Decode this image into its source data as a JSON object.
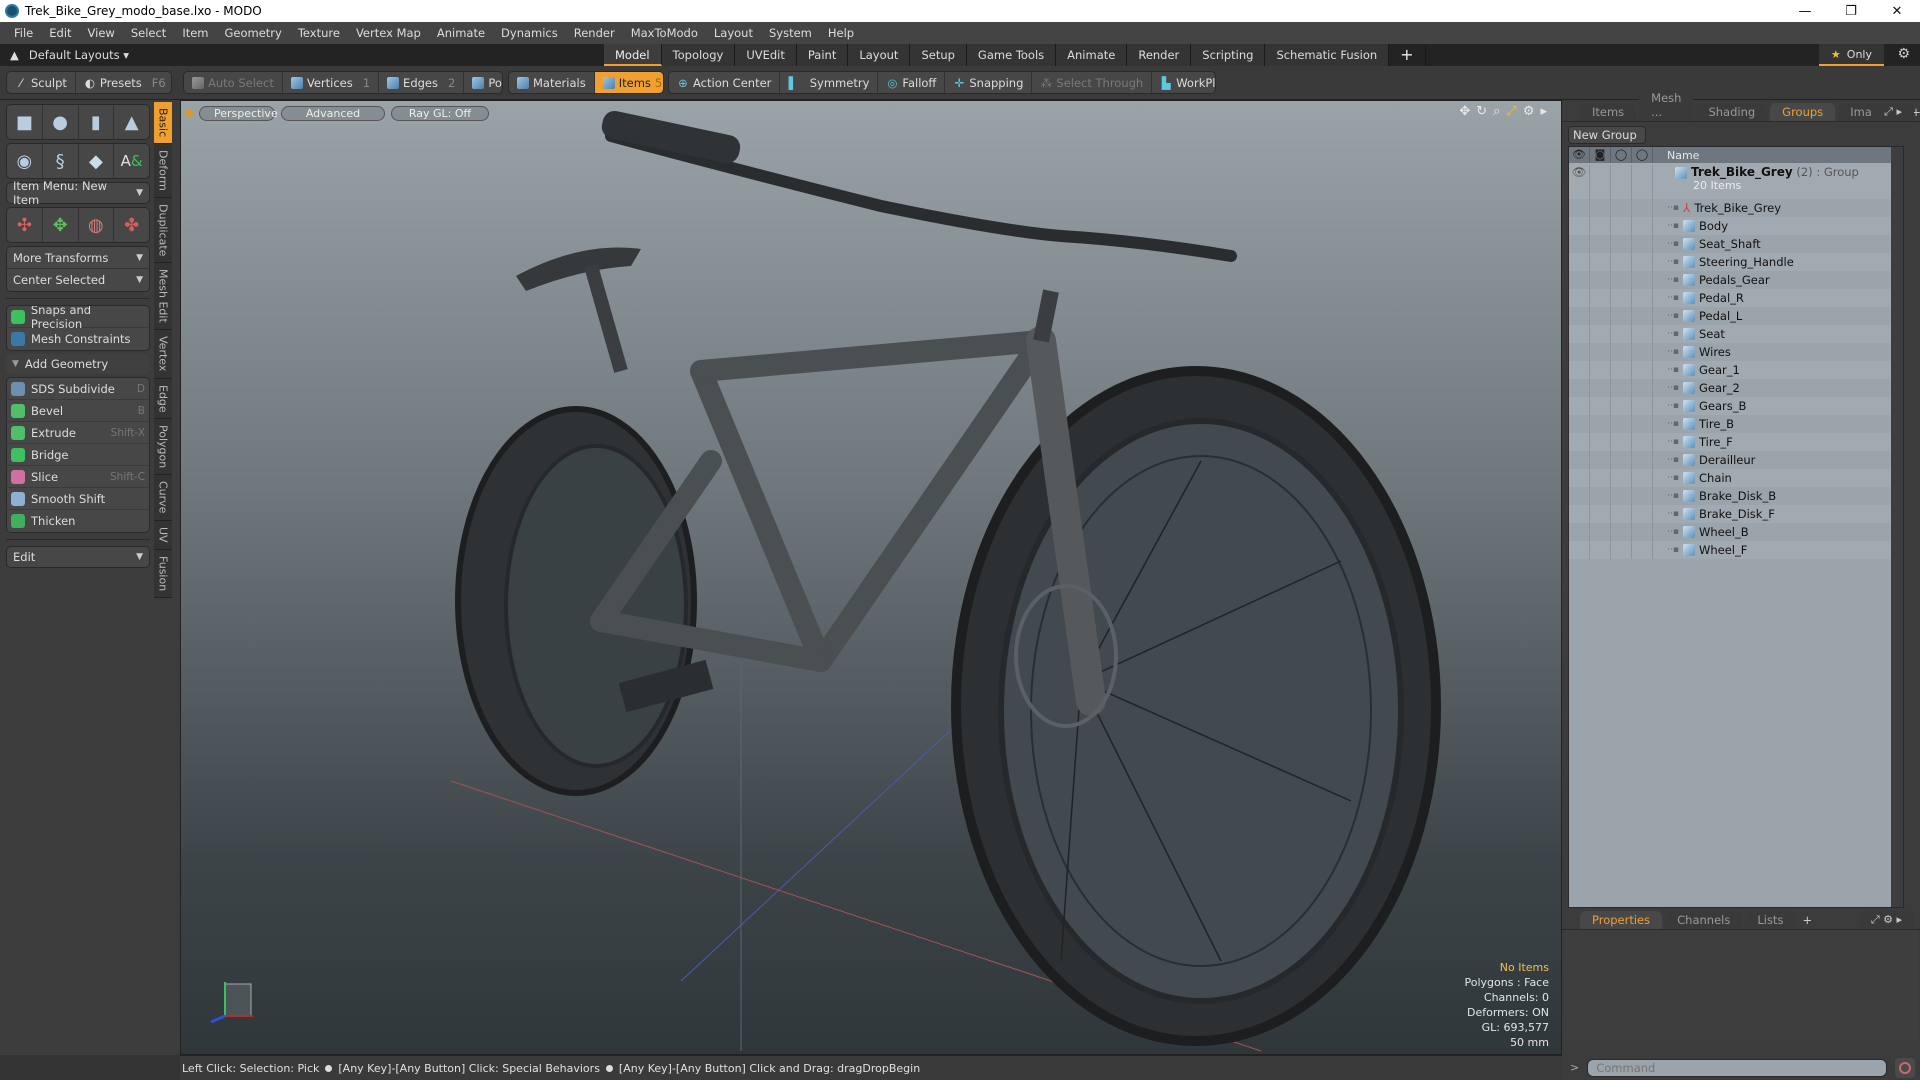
{
  "window": {
    "title": "Trek_Bike_Grey_modo_base.lxo - MODO",
    "controls": [
      "minimize",
      "restore",
      "close"
    ]
  },
  "menu": [
    "File",
    "Edit",
    "View",
    "Select",
    "Item",
    "Geometry",
    "Texture",
    "Vertex Map",
    "Animate",
    "Dynamics",
    "Render",
    "MaxToModo",
    "Layout",
    "System",
    "Help"
  ],
  "layouts": {
    "label": "Default Layouts",
    "tabs": [
      "Model",
      "Topology",
      "UVEdit",
      "Paint",
      "Layout",
      "Setup",
      "Game Tools",
      "Animate",
      "Render",
      "Scripting",
      "Schematic Fusion"
    ],
    "active_tab": "Model",
    "add": "+",
    "only_label": "Only"
  },
  "toolbar": {
    "sculpt": "Sculpt",
    "presets": "Presets",
    "presets_key": "F6",
    "auto_select": "Auto Select",
    "vertices": "Vertices",
    "vertices_key": "1",
    "edges": "Edges",
    "edges_key": "2",
    "polygons": "Polygons",
    "materials": "Materials",
    "items": "Items",
    "items_key": "5",
    "action_center": "Action Center",
    "symmetry": "Symmetry",
    "falloff": "Falloff",
    "snapping": "Snapping",
    "select_through": "Select Through",
    "workplane": "WorkPlane"
  },
  "left_panel": {
    "item_menu": "Item Menu: New Item",
    "more_transforms": "More Transforms",
    "center_selected": "Center Selected",
    "snaps": "Snaps and Precision",
    "mesh_constraints": "Mesh Constraints",
    "add_geometry": "Add Geometry",
    "tools": [
      {
        "label": "SDS Subdivide",
        "shortcut": "D",
        "color": "#6d8fb0"
      },
      {
        "label": "Bevel",
        "shortcut": "B",
        "color": "#4fbf6a"
      },
      {
        "label": "Extrude",
        "shortcut": "Shift-X",
        "color": "#4fbf6a"
      },
      {
        "label": "Bridge",
        "shortcut": "",
        "color": "#3ec060"
      },
      {
        "label": "Slice",
        "shortcut": "Shift-C",
        "color": "#d070a0"
      },
      {
        "label": "Smooth Shift",
        "shortcut": "",
        "color": "#8fb0d0"
      },
      {
        "label": "Thicken",
        "shortcut": "",
        "color": "#40b060"
      }
    ],
    "edit": "Edit",
    "vertical_tabs": [
      "Basic",
      "Deform",
      "Duplicate",
      "Mesh Edit",
      "Vertex",
      "Edge",
      "Polygon",
      "Curve",
      "UV",
      "Fusion"
    ],
    "active_vtab": "Basic"
  },
  "viewport": {
    "view": "Perspective",
    "shading": "Advanced",
    "raygl": "Ray GL: Off",
    "info": {
      "selection": "No Items",
      "mode": "Polygons : Face",
      "channels": "Channels: 0",
      "deformers": "Deformers: ON",
      "gl": "GL: 693,577",
      "scale": "50 mm"
    }
  },
  "right_panel": {
    "tabs": [
      "Items",
      "Mesh ...",
      "Shading",
      "Groups",
      "Images"
    ],
    "active_tab": "Groups",
    "new_group": "New Group",
    "name_header": "Name",
    "group": {
      "name": "Trek_Bike_Grey",
      "count": "(2)",
      "type": ": Group",
      "items": "20 Items"
    },
    "items": [
      "Trek_Bike_Grey",
      "Body",
      "Seat_Shaft",
      "Steering_Handle",
      "Pedals_Gear",
      "Pedal_R",
      "Pedal_L",
      "Seat",
      "Wires",
      "Gear_1",
      "Gear_2",
      "Gears_B",
      "Tire_B",
      "Tire_F",
      "Derailleur",
      "Chain",
      "Brake_Disk_B",
      "Brake_Disk_F",
      "Wheel_B",
      "Wheel_F"
    ],
    "prop_tabs": [
      "Properties",
      "Channels",
      "Lists"
    ],
    "active_prop_tab": "Properties",
    "command_placeholder": "Command"
  },
  "statusbar": {
    "hints": [
      "Left Click: Selection: Pick",
      "[Any Key]-[Any Button] Click: Special Behaviors",
      "[Any Key]-[Any Button] Click and Drag: dragDropBegin"
    ]
  },
  "colors": {
    "accent": "#f0a030",
    "panel": "#3c3c3c",
    "tree_bg": "#9ba4ab"
  }
}
